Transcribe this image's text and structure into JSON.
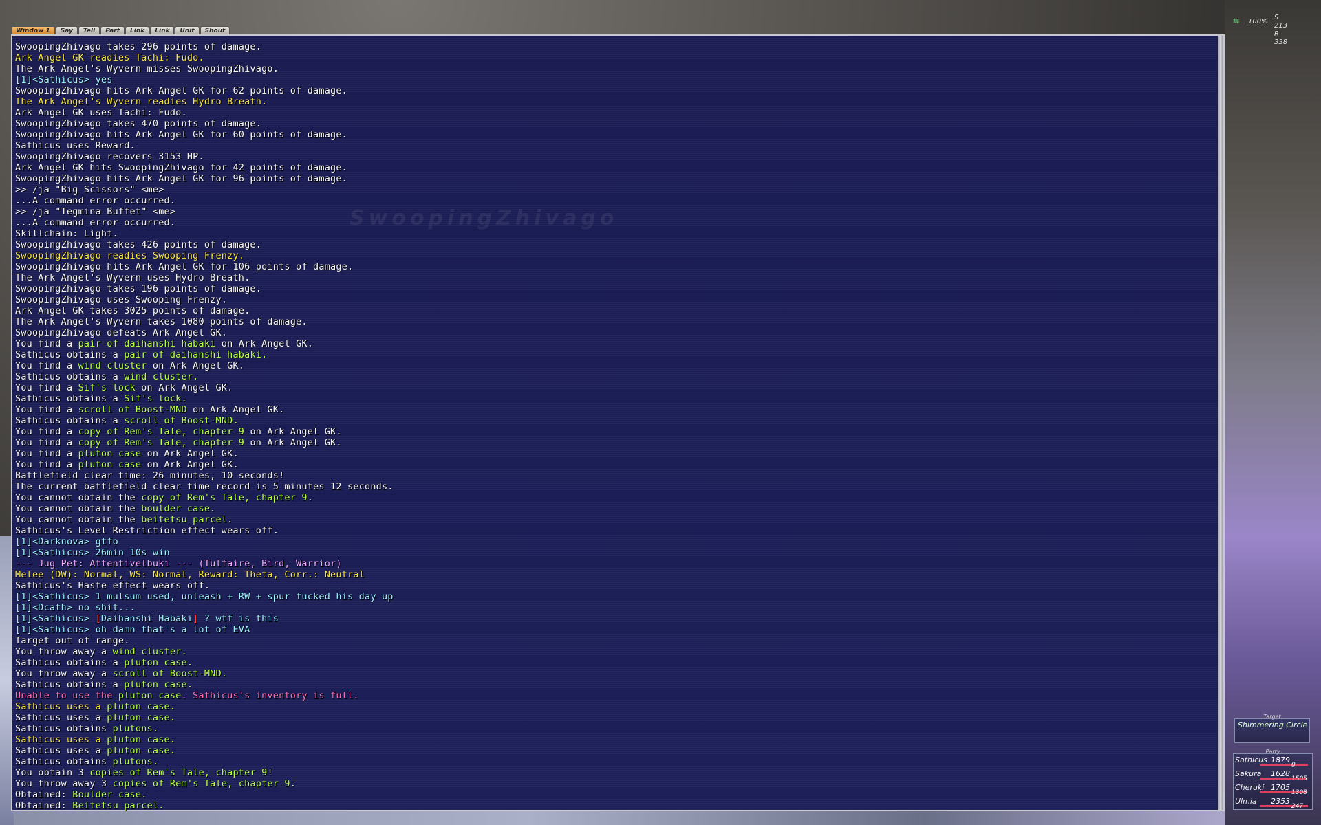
{
  "tabs": [
    "Window 1",
    "Say",
    "Tell",
    "Part",
    "Link",
    "Link",
    "Unit",
    "Shout"
  ],
  "watermark": "SwoopingZhivago",
  "hud": {
    "zoom": "100%",
    "s_coord": "S 213",
    "r_coord": "R 338",
    "target_header": "Target",
    "target_name": "Shimmering Circle",
    "party_header": "Party",
    "party": [
      {
        "name": "Sathicus",
        "hp": "1879",
        "mp": "0",
        "hp_fraction": 1.0
      },
      {
        "name": "Sakura",
        "hp": "1628",
        "mp": "1505",
        "hp_fraction": 0.95
      },
      {
        "name": "Cheruki",
        "hp": "1705",
        "mp": "1308",
        "hp_fraction": 0.97
      },
      {
        "name": "Ulmia",
        "hp": "2353",
        "mp": "247",
        "hp_fraction": 1.0
      }
    ]
  },
  "colors": {
    "chat_bg": "#1c1f58",
    "system": "#f4f4f4",
    "party_chat": "#9ff0ff",
    "readies": "#f5e63a",
    "item": "#b8ff40",
    "pet_info": "#f0a8ff",
    "error": "#ff6ab0"
  },
  "chat_lines": [
    [
      {
        "t": "SwoopingZhivago takes 296 points of damage.",
        "c": "w"
      }
    ],
    [
      {
        "t": "Ark Angel GK readies Tachi: Fudo.",
        "c": "y"
      }
    ],
    [
      {
        "t": "The Ark Angel's Wyvern misses SwoopingZhivago.",
        "c": "w"
      }
    ],
    [
      {
        "t": "[1]<Sathicus> yes",
        "c": "c"
      }
    ],
    [
      {
        "t": "SwoopingZhivago hits Ark Angel GK for 62 points of damage.",
        "c": "w"
      }
    ],
    [
      {
        "t": "The Ark Angel's Wyvern readies Hydro Breath.",
        "c": "y"
      }
    ],
    [
      {
        "t": "Ark Angel GK uses Tachi: Fudo.",
        "c": "w"
      }
    ],
    [
      {
        "t": "SwoopingZhivago takes 470 points of damage.",
        "c": "w"
      }
    ],
    [
      {
        "t": "SwoopingZhivago hits Ark Angel GK for 60 points of damage.",
        "c": "w"
      }
    ],
    [
      {
        "t": "Sathicus uses Reward.",
        "c": "w"
      }
    ],
    [
      {
        "t": "SwoopingZhivago recovers 3153 HP.",
        "c": "w"
      }
    ],
    [
      {
        "t": "Ark Angel GK hits SwoopingZhivago for 42 points of damage.",
        "c": "w"
      }
    ],
    [
      {
        "t": "SwoopingZhivago hits Ark Angel GK for 96 points of damage.",
        "c": "w"
      }
    ],
    [
      {
        "t": ">> /ja \"Big Scissors\" <me>",
        "c": "w"
      }
    ],
    [
      {
        "t": "...A command error occurred.",
        "c": "w"
      }
    ],
    [
      {
        "t": ">> /ja \"Tegmina Buffet\" <me>",
        "c": "w"
      }
    ],
    [
      {
        "t": "...A command error occurred.",
        "c": "w"
      }
    ],
    [
      {
        "t": "Skillchain: Light.",
        "c": "w"
      }
    ],
    [
      {
        "t": "SwoopingZhivago takes 426 points of damage.",
        "c": "w"
      }
    ],
    [
      {
        "t": "SwoopingZhivago readies Swooping Frenzy.",
        "c": "y"
      }
    ],
    [
      {
        "t": "SwoopingZhivago hits Ark Angel GK for 106 points of damage.",
        "c": "w"
      }
    ],
    [
      {
        "t": "The Ark Angel's Wyvern uses Hydro Breath.",
        "c": "w"
      }
    ],
    [
      {
        "t": "SwoopingZhivago takes 196 points of damage.",
        "c": "w"
      }
    ],
    [
      {
        "t": "SwoopingZhivago uses Swooping Frenzy.",
        "c": "w"
      }
    ],
    [
      {
        "t": "Ark Angel GK takes 3025 points of damage.",
        "c": "w"
      }
    ],
    [
      {
        "t": "The Ark Angel's Wyvern takes 1080 points of damage.",
        "c": "w"
      }
    ],
    [
      {
        "t": "SwoopingZhivago defeats Ark Angel GK.",
        "c": "w"
      }
    ],
    [
      {
        "t": "You find a ",
        "c": "w"
      },
      {
        "t": "pair of daihanshi habaki",
        "c": "item"
      },
      {
        "t": " on Ark Angel GK.",
        "c": "w"
      }
    ],
    [
      {
        "t": "Sathicus obtains a ",
        "c": "w"
      },
      {
        "t": "pair of daihanshi habaki.",
        "c": "item"
      }
    ],
    [
      {
        "t": "You find a ",
        "c": "w"
      },
      {
        "t": "wind cluster",
        "c": "item"
      },
      {
        "t": " on Ark Angel GK.",
        "c": "w"
      }
    ],
    [
      {
        "t": "Sathicus obtains a ",
        "c": "w"
      },
      {
        "t": "wind cluster.",
        "c": "item"
      }
    ],
    [
      {
        "t": "You find a ",
        "c": "w"
      },
      {
        "t": "Sif's lock",
        "c": "item"
      },
      {
        "t": " on Ark Angel GK.",
        "c": "w"
      }
    ],
    [
      {
        "t": "Sathicus obtains a ",
        "c": "w"
      },
      {
        "t": "Sif's lock.",
        "c": "item"
      }
    ],
    [
      {
        "t": "You find a ",
        "c": "w"
      },
      {
        "t": "scroll of Boost-MND",
        "c": "item"
      },
      {
        "t": " on Ark Angel GK.",
        "c": "w"
      }
    ],
    [
      {
        "t": "Sathicus obtains a ",
        "c": "w"
      },
      {
        "t": "scroll of Boost-MND.",
        "c": "item"
      }
    ],
    [
      {
        "t": "You find a ",
        "c": "w"
      },
      {
        "t": "copy of Rem's Tale, chapter 9",
        "c": "item"
      },
      {
        "t": " on Ark Angel GK.",
        "c": "w"
      }
    ],
    [
      {
        "t": "You find a ",
        "c": "w"
      },
      {
        "t": "copy of Rem's Tale, chapter 9",
        "c": "item"
      },
      {
        "t": " on Ark Angel GK.",
        "c": "w"
      }
    ],
    [
      {
        "t": "You find a ",
        "c": "w"
      },
      {
        "t": "pluton case",
        "c": "item"
      },
      {
        "t": " on Ark Angel GK.",
        "c": "w"
      }
    ],
    [
      {
        "t": "You find a ",
        "c": "w"
      },
      {
        "t": "pluton case",
        "c": "item"
      },
      {
        "t": " on Ark Angel GK.",
        "c": "w"
      }
    ],
    [
      {
        "t": "Battlefield clear time: 26 minutes, 10 seconds!",
        "c": "w"
      }
    ],
    [
      {
        "t": "The current battlefield clear time record is 5 minutes 12 seconds.",
        "c": "w"
      }
    ],
    [
      {
        "t": "You cannot obtain the ",
        "c": "w"
      },
      {
        "t": "copy of Rem's Tale, chapter 9",
        "c": "item"
      },
      {
        "t": ".",
        "c": "w"
      }
    ],
    [
      {
        "t": "You cannot obtain the ",
        "c": "w"
      },
      {
        "t": "boulder case",
        "c": "item"
      },
      {
        "t": ".",
        "c": "w"
      }
    ],
    [
      {
        "t": "You cannot obtain the ",
        "c": "w"
      },
      {
        "t": "beitetsu parcel",
        "c": "item"
      },
      {
        "t": ".",
        "c": "w"
      }
    ],
    [
      {
        "t": "Sathicus's Level Restriction effect wears off.",
        "c": "w"
      }
    ],
    [
      {
        "t": "[1]<Darknova> gtfo",
        "c": "c"
      }
    ],
    [
      {
        "t": "[1]<Sathicus> 26min 10s win",
        "c": "c"
      }
    ],
    [
      {
        "t": "--- Jug Pet: Attentivelbuki --- (Tulfaire, Bird, Warrior)",
        "c": "p"
      }
    ],
    [
      {
        "t": "Melee (DW): Normal, WS: Normal, Reward: Theta, Corr.: Neutral",
        "c": "y"
      }
    ],
    [
      {
        "t": "Sathicus's Haste effect wears off.",
        "c": "w"
      }
    ],
    [
      {
        "t": "[1]<Sathicus> 1 mulsum used, unleash + RW + spur fucked his day up",
        "c": "c"
      }
    ],
    [
      {
        "t": "[1]<Dcath> no shit...",
        "c": "c"
      }
    ],
    [
      {
        "t": "[1]<Sathicus> ",
        "c": "c"
      },
      {
        "t": "[",
        "c": "mk"
      },
      {
        "t": "Daihanshi Habaki",
        "c": "c"
      },
      {
        "t": "]",
        "c": "mk"
      },
      {
        "t": " ? wtf is this",
        "c": "c"
      }
    ],
    [
      {
        "t": "[1]<Sathicus> oh damn that's a lot of EVA",
        "c": "c"
      }
    ],
    [
      {
        "t": "Target out of range.",
        "c": "w"
      }
    ],
    [
      {
        "t": "You throw away a ",
        "c": "w"
      },
      {
        "t": "wind cluster.",
        "c": "item"
      }
    ],
    [
      {
        "t": "Sathicus obtains a ",
        "c": "w"
      },
      {
        "t": "pluton case.",
        "c": "item"
      }
    ],
    [
      {
        "t": "You throw away a ",
        "c": "w"
      },
      {
        "t": "scroll of Boost-MND.",
        "c": "item"
      }
    ],
    [
      {
        "t": "Sathicus obtains a ",
        "c": "w"
      },
      {
        "t": "pluton case.",
        "c": "item"
      }
    ],
    [
      {
        "t": "Unable to use the ",
        "c": "m"
      },
      {
        "t": "pluton case",
        "c": "item"
      },
      {
        "t": ". Sathicus's inventory is full.",
        "c": "m"
      }
    ],
    [
      {
        "t": "Sathicus uses a ",
        "c": "y"
      },
      {
        "t": "pluton case.",
        "c": "item"
      }
    ],
    [
      {
        "t": "Sathicus uses a ",
        "c": "w"
      },
      {
        "t": "pluton case.",
        "c": "item"
      }
    ],
    [
      {
        "t": "Sathicus obtains ",
        "c": "w"
      },
      {
        "t": "plutons.",
        "c": "item"
      }
    ],
    [
      {
        "t": "Sathicus uses a ",
        "c": "y"
      },
      {
        "t": "pluton case.",
        "c": "item"
      }
    ],
    [
      {
        "t": "Sathicus uses a ",
        "c": "w"
      },
      {
        "t": "pluton case.",
        "c": "item"
      }
    ],
    [
      {
        "t": "Sathicus obtains ",
        "c": "w"
      },
      {
        "t": "plutons.",
        "c": "item"
      }
    ],
    [
      {
        "t": "You obtain 3 ",
        "c": "w"
      },
      {
        "t": "copies of Rem's Tale, chapter 9",
        "c": "item"
      },
      {
        "t": "!",
        "c": "w"
      }
    ],
    [
      {
        "t": "You throw away 3 ",
        "c": "w"
      },
      {
        "t": "copies of Rem's Tale, chapter 9.",
        "c": "item"
      }
    ],
    [
      {
        "t": "Obtained: ",
        "c": "w"
      },
      {
        "t": "Boulder case.",
        "c": "item"
      }
    ],
    [
      {
        "t": "Obtained: ",
        "c": "w"
      },
      {
        "t": "Beitetsu parcel.",
        "c": "item"
      }
    ]
  ]
}
